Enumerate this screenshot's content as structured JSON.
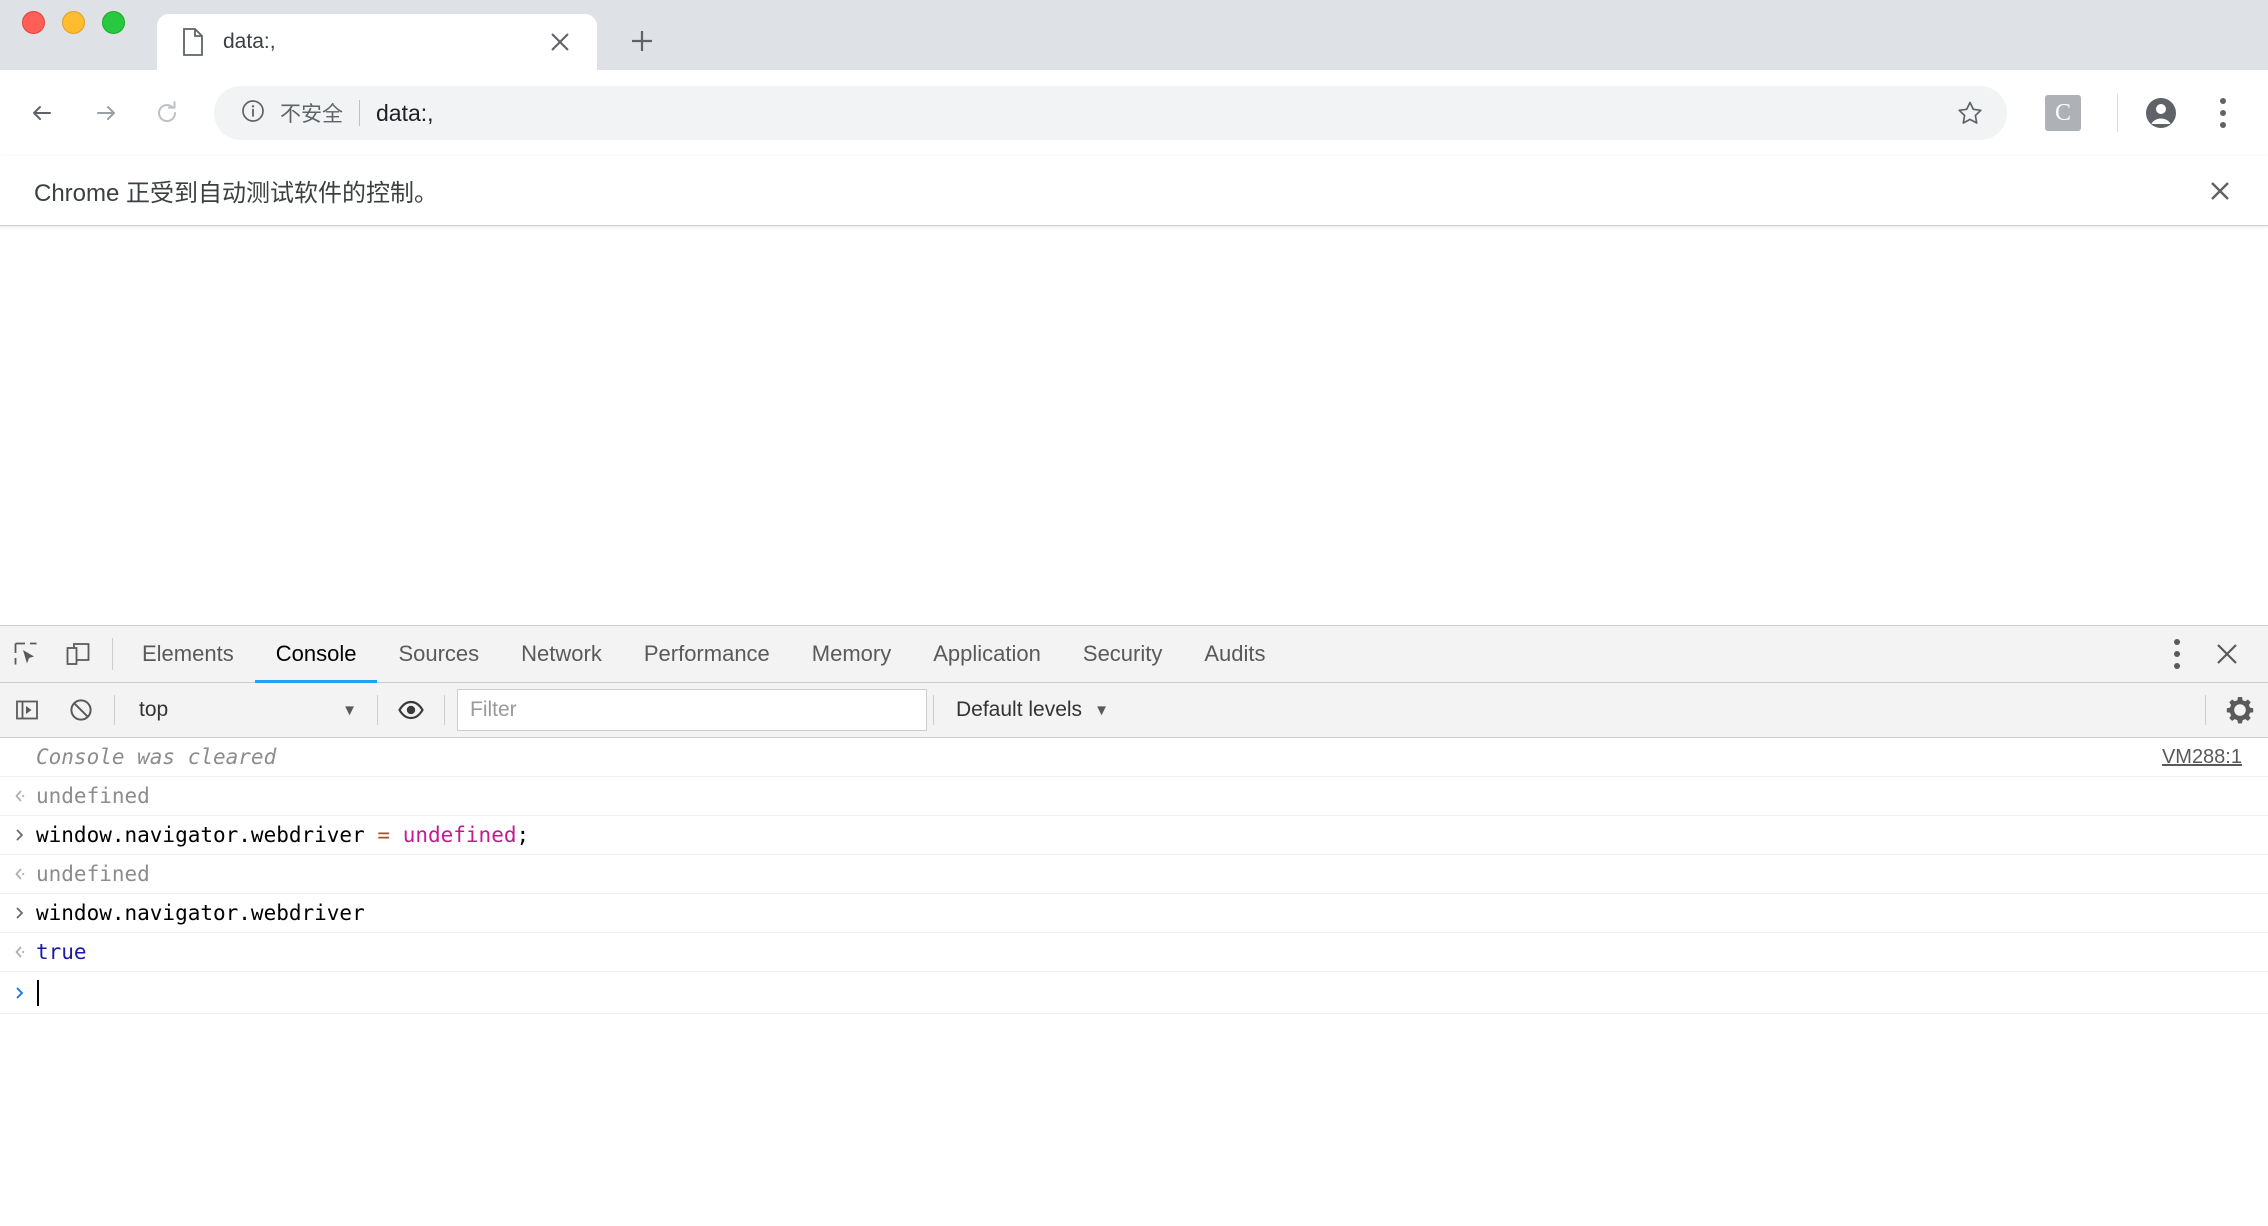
{
  "window": {
    "traffic_lights": [
      "close",
      "minimize",
      "maximize"
    ]
  },
  "tabstrip": {
    "tab": {
      "title": "data:,",
      "favicon": "document-icon",
      "close_label": "×"
    },
    "new_tab_label": "+"
  },
  "toolbar": {
    "back_icon": "arrow-left-icon",
    "forward_icon": "arrow-right-icon",
    "reload_icon": "reload-icon",
    "omnibox": {
      "security_icon": "info-circle-icon",
      "security_text": "不安全",
      "url": "data:,",
      "star_icon": "bookmark-star-icon"
    },
    "extension_badge": "C",
    "profile_icon": "account-circle-icon",
    "menu_icon": "three-dot-menu-icon"
  },
  "infobar": {
    "message": "Chrome 正受到自动测试软件的控制。",
    "close_label": "✕"
  },
  "devtools": {
    "inspect_icon": "inspect-element-icon",
    "device_icon": "device-toolbar-icon",
    "tabs": [
      {
        "label": "Elements",
        "active": false
      },
      {
        "label": "Console",
        "active": true
      },
      {
        "label": "Sources",
        "active": false
      },
      {
        "label": "Network",
        "active": false
      },
      {
        "label": "Performance",
        "active": false
      },
      {
        "label": "Memory",
        "active": false
      },
      {
        "label": "Application",
        "active": false
      },
      {
        "label": "Security",
        "active": false
      },
      {
        "label": "Audits",
        "active": false
      }
    ],
    "more_icon": "three-dot-menu-icon",
    "close_label": "✕",
    "filterbar": {
      "sidebar_icon": "console-sidebar-icon",
      "clear_icon": "clear-console-icon",
      "context": "top",
      "context_caret": "▼",
      "eye_icon": "live-expression-eye-icon",
      "filter_placeholder": "Filter",
      "filter_value": "",
      "levels_label": "Default levels",
      "levels_caret": "▼",
      "settings_icon": "gear-icon"
    },
    "console": {
      "accent_blue": "#21a1f1",
      "colors": {
        "keyword": "#c41a8f",
        "operator": "#a6512a",
        "boolean": "#1a1aa6",
        "muted": "#8c8c8c"
      },
      "rows": [
        {
          "kind": "cleared",
          "indicator": "",
          "text": "Console was cleared",
          "source": "VM288:1"
        },
        {
          "kind": "output",
          "indicator": "output-arrow-icon",
          "text": "undefined",
          "source": ""
        },
        {
          "kind": "input",
          "indicator": "input-chevron-icon",
          "text": "window.navigator.webdriver = undefined;",
          "parts": [
            {
              "t": "window.navigator.webdriver ",
              "c": "plain"
            },
            {
              "t": "=",
              "c": "operator"
            },
            {
              "t": " ",
              "c": "plain"
            },
            {
              "t": "undefined",
              "c": "keyword"
            },
            {
              "t": ";",
              "c": "punc"
            }
          ],
          "source": ""
        },
        {
          "kind": "output",
          "indicator": "output-arrow-icon",
          "text": "undefined",
          "source": ""
        },
        {
          "kind": "input",
          "indicator": "input-chevron-icon",
          "text": "window.navigator.webdriver",
          "source": ""
        },
        {
          "kind": "output",
          "indicator": "output-arrow-icon",
          "text": "true",
          "value_type": "boolean",
          "source": ""
        },
        {
          "kind": "prompt",
          "indicator": "input-chevron-icon",
          "text": "",
          "source": ""
        }
      ]
    }
  }
}
